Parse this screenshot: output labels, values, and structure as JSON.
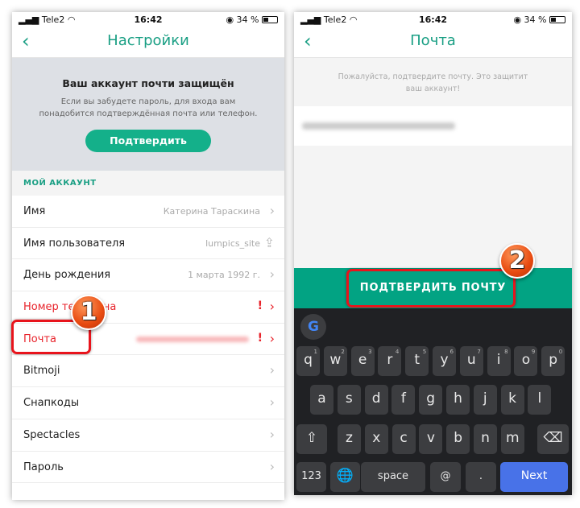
{
  "status": {
    "carrier": "Tele2",
    "time": "16:42",
    "battery": "34 %"
  },
  "left": {
    "title": "Настройки",
    "banner": {
      "heading": "Ваш аккаунт почти защищён",
      "text1": "Если вы забудете пароль, для входа вам",
      "text2": "понадобится подтверждённая почта или телефон.",
      "button": "Подтвердить"
    },
    "section": "МОЙ АККАУНТ",
    "rows": [
      {
        "label": "Имя",
        "value": "Катерина Тараскина"
      },
      {
        "label": "Имя пользователя",
        "value": "lumpics_site"
      },
      {
        "label": "День рождения",
        "value": "1 марта 1992 г."
      },
      {
        "label": "Номер телефона",
        "value": ""
      },
      {
        "label": "Почта",
        "value": ""
      },
      {
        "label": "Bitmoji",
        "value": ""
      },
      {
        "label": "Снапкоды",
        "value": ""
      },
      {
        "label": "Spectacles",
        "value": ""
      },
      {
        "label": "Пароль",
        "value": ""
      }
    ],
    "badge": "1"
  },
  "right": {
    "title": "Почта",
    "info1": "Пожалуйста, подтвердите почту. Это защитит",
    "info2": "ваш аккаунт!",
    "confirm_button": "ПОДТВЕРДИТЬ ПОЧТУ",
    "badge": "2",
    "keyboard": {
      "row1": [
        "q",
        "w",
        "e",
        "r",
        "t",
        "y",
        "u",
        "i",
        "o",
        "p"
      ],
      "row1_hints": [
        "1",
        "2",
        "3",
        "4",
        "5",
        "6",
        "7",
        "8",
        "9",
        "0"
      ],
      "row2": [
        "a",
        "s",
        "d",
        "f",
        "g",
        "h",
        "j",
        "k",
        "l"
      ],
      "row3": [
        "z",
        "x",
        "c",
        "v",
        "b",
        "n",
        "m"
      ],
      "num": "123",
      "space": "space",
      "at": "@",
      "dot": ".",
      "next": "Next"
    }
  },
  "colors": {
    "accent": "#1a9f84",
    "button": "#14b08a",
    "error": "#e8232b",
    "next": "#4872e8"
  }
}
